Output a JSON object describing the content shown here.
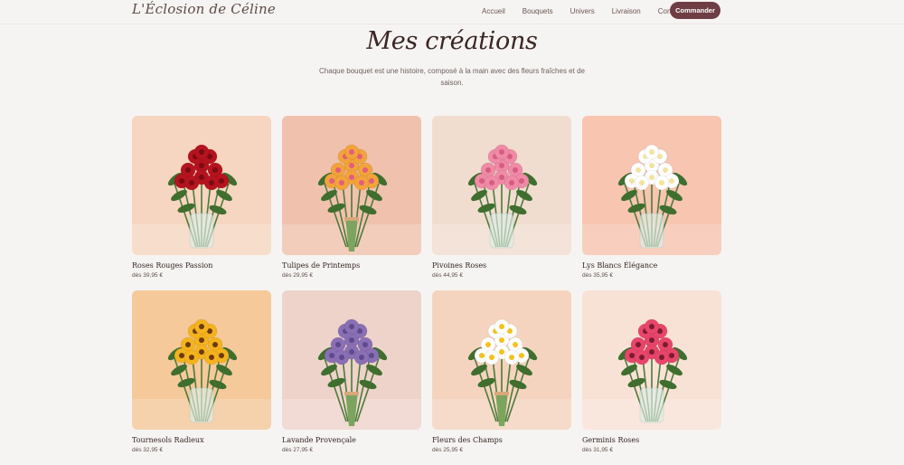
{
  "header": {
    "logo": "L'Éclosion de Céline",
    "nav": [
      "Accueil",
      "Bouquets",
      "Univers",
      "Livraison",
      "Contact"
    ],
    "cta": "Commander"
  },
  "hero": {
    "title": "Mes créations",
    "subtitle": "Chaque bouquet est une histoire, composé à la main avec des fleurs fraîches et de saison."
  },
  "products": [
    {
      "name": "Roses Rouges Passion",
      "price": "dès 39,95 €",
      "bg": "#f6d6c0",
      "flower": "#b5131f",
      "center": "#7a0b12",
      "vase": true,
      "icon": "roses-bouquet-image"
    },
    {
      "name": "Tulipes de Printemps",
      "price": "dès 29,95 €",
      "bg": "#f0c2ae",
      "flower": "#f2a33a",
      "center": "#e35d7e",
      "vase": false,
      "icon": "tulips-bouquet-image"
    },
    {
      "name": "Pivoines Roses",
      "price": "dès 44,95 €",
      "bg": "#f1ddd0",
      "flower": "#f08aa6",
      "center": "#d65d80",
      "vase": true,
      "icon": "peonies-bouquet-image"
    },
    {
      "name": "Lys Blancs Élégance",
      "price": "dès 35,95 €",
      "bg": "#f7c5b0",
      "flower": "#ffffff",
      "center": "#f2e3a0",
      "vase": true,
      "icon": "lilies-bouquet-image"
    },
    {
      "name": "Tournesols Radieux",
      "price": "dès 32,95 €",
      "bg": "#f5c99a",
      "flower": "#f4b31d",
      "center": "#6b3a14",
      "vase": true,
      "icon": "sunflowers-bouquet-image"
    },
    {
      "name": "Lavande Provençale",
      "price": "dès 27,95 €",
      "bg": "#eed3cb",
      "flower": "#8a6fb5",
      "center": "#5e4a8a",
      "vase": false,
      "icon": "lavender-bouquet-image"
    },
    {
      "name": "Fleurs des Champs",
      "price": "dès 25,95 €",
      "bg": "#f5d4bf",
      "flower": "#ffffff",
      "center": "#f4c11d",
      "vase": false,
      "icon": "wildflowers-bouquet-image"
    },
    {
      "name": "Germinis Roses",
      "price": "dès 31,95 €",
      "bg": "#f8e2d6",
      "flower": "#e8456a",
      "center": "#7a1c30",
      "vase": true,
      "icon": "gerberas-bouquet-image"
    }
  ]
}
